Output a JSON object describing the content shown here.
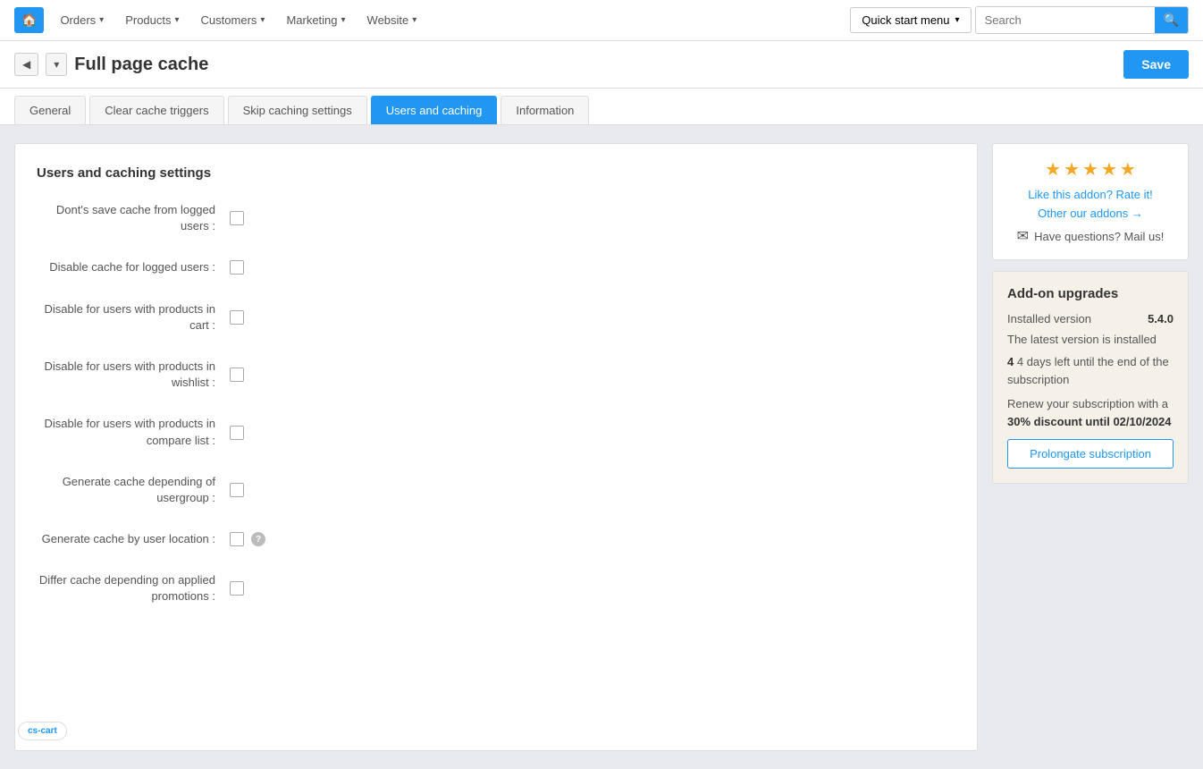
{
  "topbar": {
    "home_icon": "🏠",
    "nav_items": [
      {
        "label": "Orders",
        "has_dropdown": true
      },
      {
        "label": "Products",
        "has_dropdown": true
      },
      {
        "label": "Customers",
        "has_dropdown": true
      },
      {
        "label": "Marketing",
        "has_dropdown": true
      },
      {
        "label": "Website",
        "has_dropdown": true
      }
    ],
    "quick_menu_label": "Quick start menu",
    "search_placeholder": "Search"
  },
  "page_header": {
    "title": "Full page cache",
    "save_label": "Save"
  },
  "tabs": [
    {
      "label": "General",
      "active": false
    },
    {
      "label": "Clear cache triggers",
      "active": false
    },
    {
      "label": "Skip caching settings",
      "active": false
    },
    {
      "label": "Users and caching",
      "active": true
    },
    {
      "label": "Information",
      "active": false
    }
  ],
  "section": {
    "title": "Users and caching settings",
    "fields": [
      {
        "label": "Dont's save cache from logged users :",
        "has_help": false
      },
      {
        "label": "Disable cache for logged users :",
        "has_help": false
      },
      {
        "label": "Disable for users with products in cart :",
        "has_help": false
      },
      {
        "label": "Disable for users with products in wishlist :",
        "has_help": false
      },
      {
        "label": "Disable for users with products in compare list :",
        "has_help": false
      },
      {
        "label": "Generate cache depending of usergroup :",
        "has_help": false
      },
      {
        "label": "Generate cache by user location :",
        "has_help": true
      },
      {
        "label": "Differ cache depending on applied promotions :",
        "has_help": false
      }
    ]
  },
  "sidebar": {
    "stars": [
      "★",
      "★",
      "★",
      "★",
      "★"
    ],
    "rate_text": "Like this addon? Rate it!",
    "other_addons_text": "Other our addons →",
    "mail_text": "Have questions? Mail us!",
    "addon_upgrades": {
      "title": "Add-on upgrades",
      "installed_version_label": "Installed version",
      "installed_version_value": "5.4.0",
      "latest_version_text": "The latest version is installed",
      "days_left_text": "4 days left until the end of the subscription",
      "renew_text": "Renew your subscription with a",
      "discount_text": "30% discount until 02/10/2024",
      "prolong_label": "Prolongate subscription"
    }
  },
  "bottom": {
    "logo_text": "cs-cart"
  }
}
